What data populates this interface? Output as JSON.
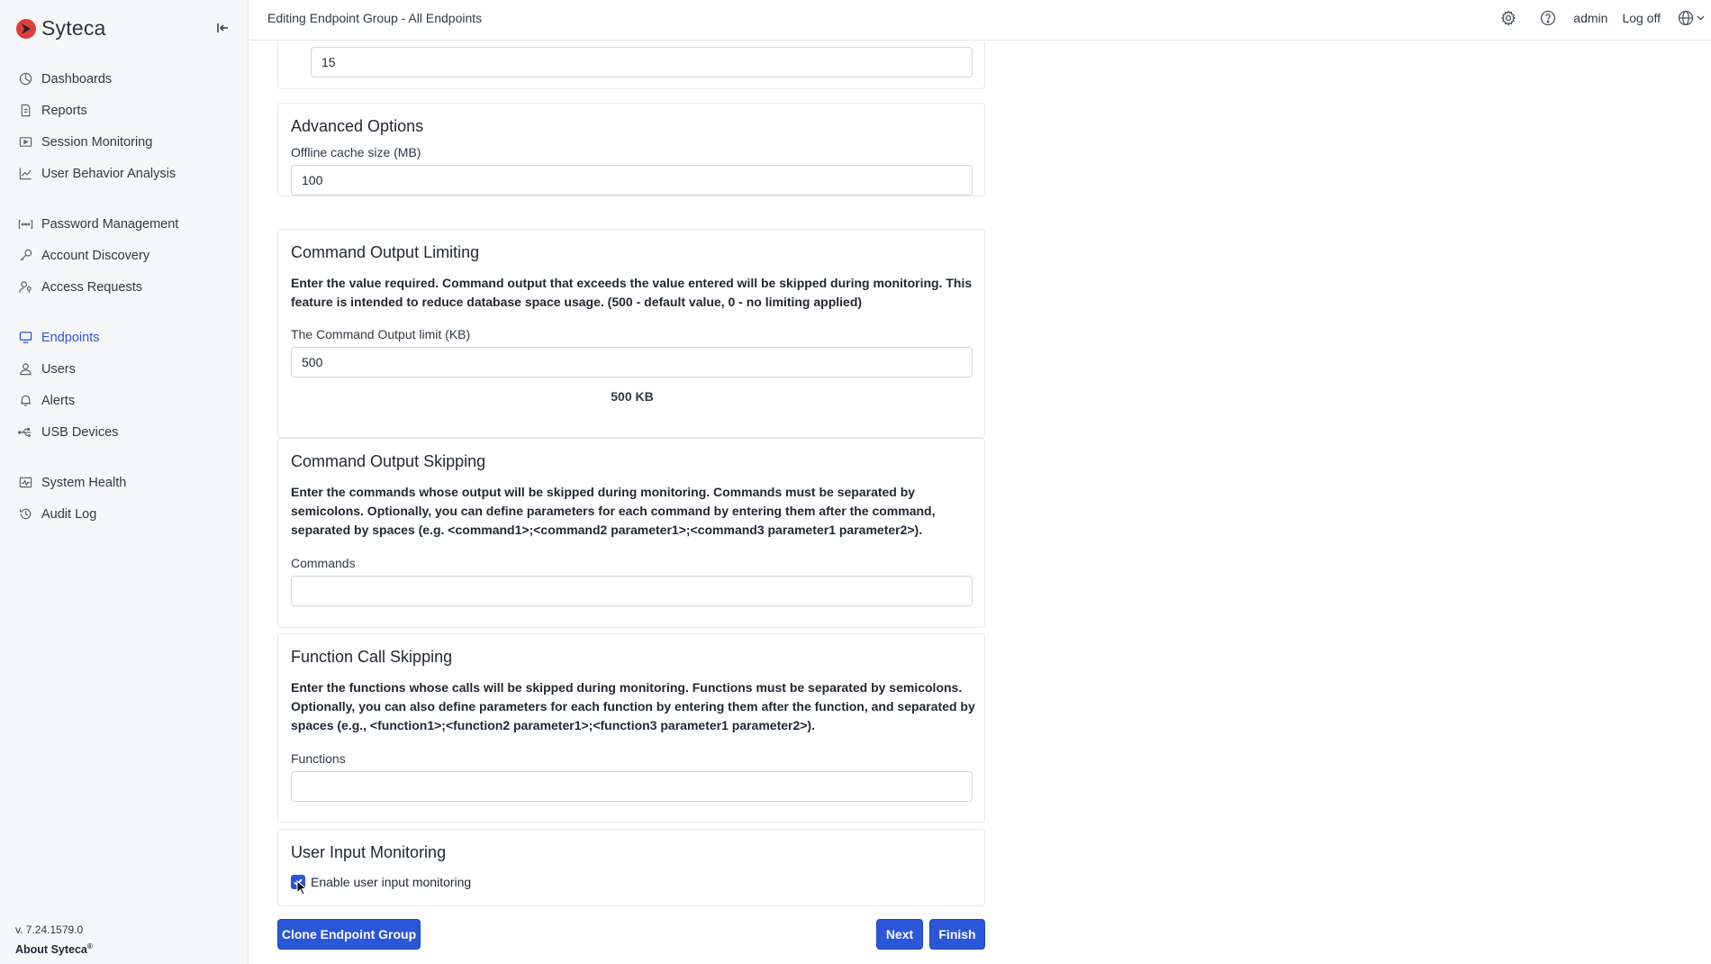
{
  "app": {
    "brand": "Syteca",
    "page_title": "Editing Endpoint Group - All Endpoints"
  },
  "sidebar": {
    "groups": [
      [
        {
          "label": "Dashboards",
          "icon": "dashboard-icon"
        },
        {
          "label": "Reports",
          "icon": "report-icon"
        },
        {
          "label": "Session Monitoring",
          "icon": "play-icon"
        },
        {
          "label": "User Behavior Analysis",
          "icon": "chart-icon"
        }
      ],
      [
        {
          "label": "Password Management",
          "icon": "password-icon"
        },
        {
          "label": "Account Discovery",
          "icon": "key-icon"
        },
        {
          "label": "Access Requests",
          "icon": "user-key-icon"
        }
      ],
      [
        {
          "label": "Endpoints",
          "icon": "monitor-icon",
          "active": true
        },
        {
          "label": "Users",
          "icon": "user-icon"
        },
        {
          "label": "Alerts",
          "icon": "bell-icon"
        },
        {
          "label": "USB Devices",
          "icon": "usb-icon"
        }
      ],
      [
        {
          "label": "System Health",
          "icon": "health-icon"
        },
        {
          "label": "Audit Log",
          "icon": "history-icon"
        }
      ]
    ],
    "version": "v. 7.24.1579.0",
    "about": "About Syteca",
    "about_sup": "®"
  },
  "header": {
    "user": "admin",
    "logoff": "Log off"
  },
  "sections": {
    "top_value": "15",
    "advanced": {
      "title": "Advanced Options",
      "label": "Offline cache size (MB)",
      "value": "100"
    },
    "output_limiting": {
      "title": "Command Output Limiting",
      "description": "Enter the value required. Command output that exceeds the value entered will be skipped during monitoring. This feature is intended to reduce database space usage. (500 - default value, 0 - no limiting applied)",
      "label": "The Command Output limit (KB)",
      "value": "500",
      "hint": "500 KB"
    },
    "output_skipping": {
      "title": "Command Output Skipping",
      "description": "Enter the commands whose output will be skipped during monitoring. Commands must be separated by semicolons. Optionally, you can define parameters for each command by entering them after the command, separated by spaces (e.g. <command1>;<command2 parameter1>;<command3 parameter1 parameter2>).",
      "label": "Commands",
      "value": ""
    },
    "function_skipping": {
      "title": "Function Call Skipping",
      "description": "Enter the functions whose calls will be skipped during monitoring. Functions must be separated by semicolons. Optionally, you can also define parameters for each function by entering them after the function, and separated by spaces (e.g., <function1>;<function2 parameter1>;<function3 parameter1 parameter2>).",
      "label": "Functions",
      "value": ""
    },
    "user_input": {
      "title": "User Input Monitoring",
      "checkbox_label": "Enable user input monitoring",
      "checked": true
    }
  },
  "buttons": {
    "clone": "Clone Endpoint Group",
    "next": "Next",
    "finish": "Finish"
  },
  "colors": {
    "accent": "#2a56d8",
    "brand_red": "#e23a3a"
  }
}
